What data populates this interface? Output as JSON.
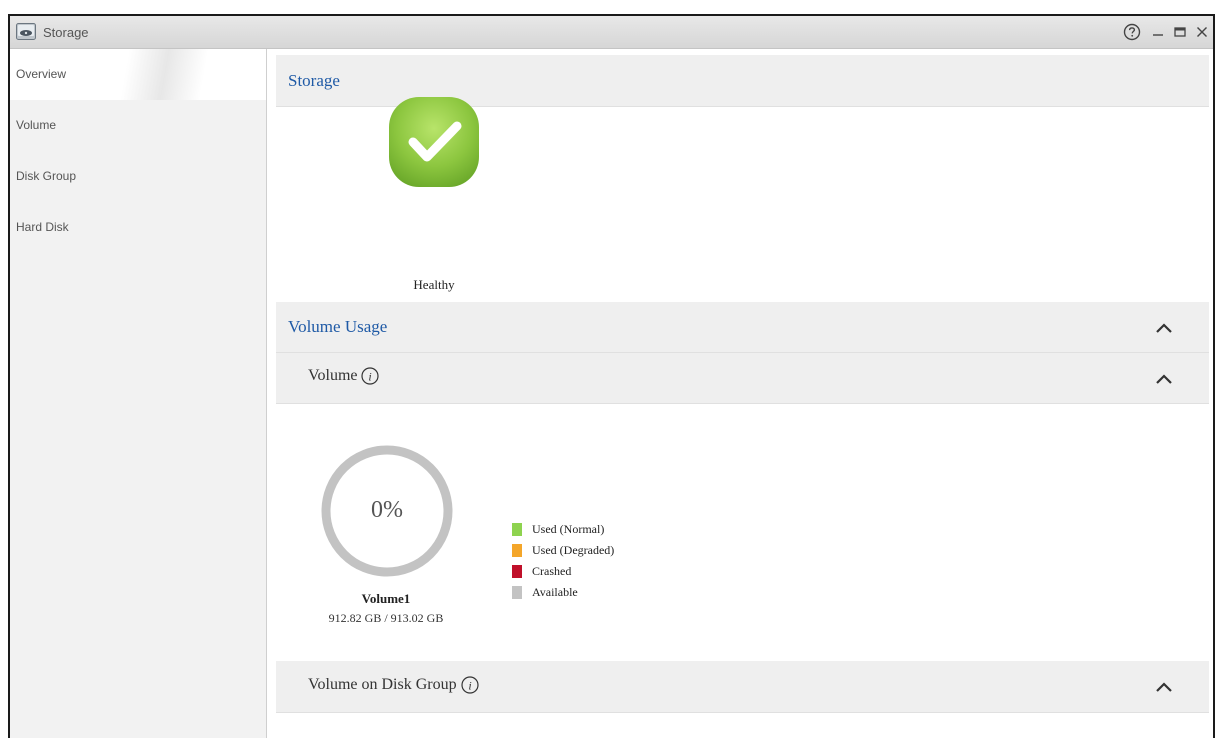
{
  "window": {
    "title": "Storage",
    "controls": [
      "help",
      "minimize",
      "maximize",
      "close"
    ]
  },
  "sidebar": {
    "items": [
      {
        "label": "Overview",
        "active": true
      },
      {
        "label": "Volume",
        "active": false
      },
      {
        "label": "Disk Group",
        "active": false
      },
      {
        "label": "Hard Disk",
        "active": false
      }
    ]
  },
  "storage": {
    "title": "Storage",
    "status_icon": "check-icon",
    "status_label": "Healthy",
    "status_color": "#8cc63f"
  },
  "volume_usage": {
    "title": "Volume Usage",
    "volume_section": {
      "title": "Volume",
      "percent_text": "0%",
      "percent_used": 0,
      "volume_name": "Volume1",
      "capacity_text": "912.82 GB / 913.02 GB"
    },
    "legend": [
      {
        "label": "Used (Normal)",
        "color": "#8ed34f"
      },
      {
        "label": "Used (Degraded)",
        "color": "#f4a62a"
      },
      {
        "label": "Crashed",
        "color": "#c0102a"
      },
      {
        "label": "Available",
        "color": "#c3c3c3"
      }
    ],
    "disk_group_section": {
      "title": "Volume on Disk Group"
    }
  }
}
